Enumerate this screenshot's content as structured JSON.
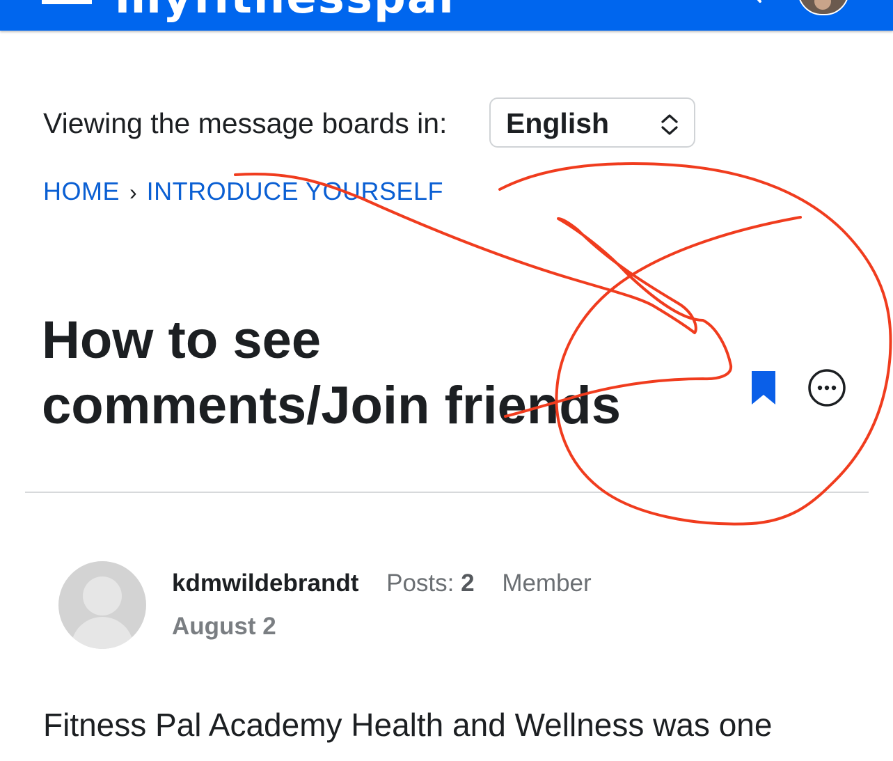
{
  "header": {
    "app_name": "myfitnesspal",
    "icons": [
      "menu-icon",
      "search-icon",
      "avatar"
    ],
    "brand_color": "#0066ee"
  },
  "language": {
    "label": "Viewing the message boards in:",
    "selected": "English"
  },
  "breadcrumb": {
    "items": [
      {
        "label": "HOME"
      },
      {
        "label": "INTRODUCE YOURSELF"
      }
    ],
    "separator": "›"
  },
  "thread": {
    "title_line1": "How to see",
    "title_line2": "comments/Join friends",
    "actions": [
      "bookmark-icon",
      "more-options-icon"
    ]
  },
  "post": {
    "author": "kdmwildebrandt",
    "posts_label": "Posts:",
    "posts_count": "2",
    "role": "Member",
    "date": "August 2",
    "body": "Fitness Pal Academy Health and Wellness was one"
  },
  "annotation": {
    "color": "#f03c1e"
  }
}
